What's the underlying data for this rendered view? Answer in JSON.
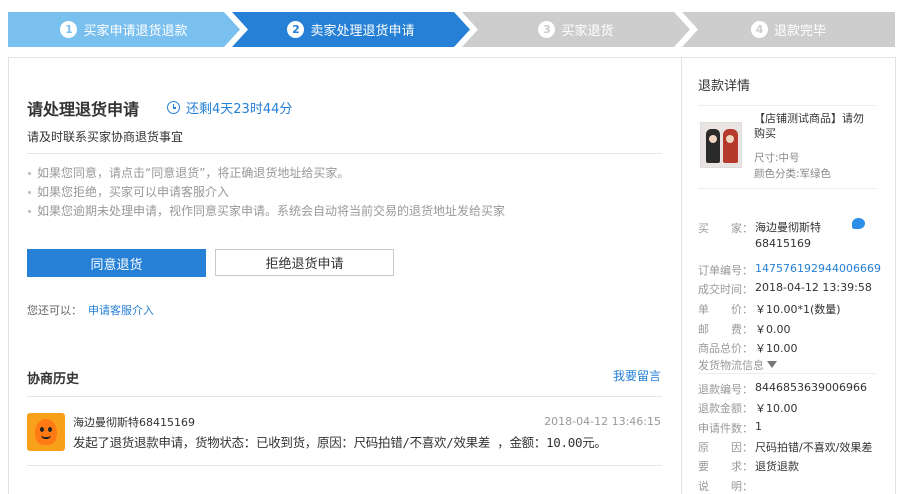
{
  "steps": [
    {
      "num": "1",
      "label": "买家申请退货退款"
    },
    {
      "num": "2",
      "label": "卖家处理退货申请"
    },
    {
      "num": "3",
      "label": "买家退货"
    },
    {
      "num": "4",
      "label": "退款完毕"
    }
  ],
  "main": {
    "title": "请处理退货申请",
    "timer": "还剩4天23时44分",
    "subtitle": "请及时联系买家协商退货事宜",
    "tips": [
      "如果您同意，请点击“同意退货”，将正确退货地址给买家。",
      "如果您拒绝，买家可以申请客服介入",
      "如果您逾期未处理申请，视作同意买家申请。系统会自动将当前交易的退货地址发给买家"
    ],
    "agree_button": "同意退货",
    "reject_button": "拒绝退货申请",
    "also_label": "您还可以：",
    "also_link": "申请客服介入"
  },
  "history": {
    "title": "协商历史",
    "leave_message": "我要留言",
    "entries": [
      {
        "user": "海边曼彻斯特68415169",
        "time": "2018-04-12 13:46:15",
        "text": "发起了退货退款申请，货物状态：已收到货，原因：尺码拍错/不喜欢/效果差 ，金额：10.00元。"
      }
    ]
  },
  "refund": {
    "title": "退款详情",
    "product_name": "【店铺测试商品】请勿购买",
    "product_size": "尺寸:中号",
    "product_color": "颜色分类:军绿色",
    "buyer_key": "买　　家：",
    "buyer_value": "海边曼彻斯特68415169",
    "order_no_key": "订单编号：",
    "order_no": "147576192944006669",
    "deal_time_key": "成交时间：",
    "deal_time": "2018-04-12 13:39:58",
    "unit_price_key": "单　　价：",
    "unit_price": "￥10.00*1(数量)",
    "postage_key": "邮　　费：",
    "postage": "￥0.00",
    "total_key": "商品总价：",
    "total": "￥10.00",
    "shipping_info": "发货物流信息",
    "refund_no_key": "退款编号：",
    "refund_no": "8446853639006966",
    "refund_amount_key": "退款金额：",
    "refund_amount": "￥10.00",
    "apply_count_key": "申请件数：",
    "apply_count": "1",
    "reason_key": "原　　因：",
    "reason": "尺码拍错/不喜欢/效果差",
    "request_key": "要　　求：",
    "request": "退货退款",
    "desc_key": "说　　明："
  },
  "colors": {
    "step_done": "#7ac0ef",
    "step_active": "#2580d6",
    "step_todo": "#cdcdcd",
    "accent": "#2580d6"
  },
  "icons": [
    "clock-icon",
    "wangwang-chat-icon",
    "chevron-down-icon",
    "avatar-image",
    "product-thumbnail"
  ]
}
